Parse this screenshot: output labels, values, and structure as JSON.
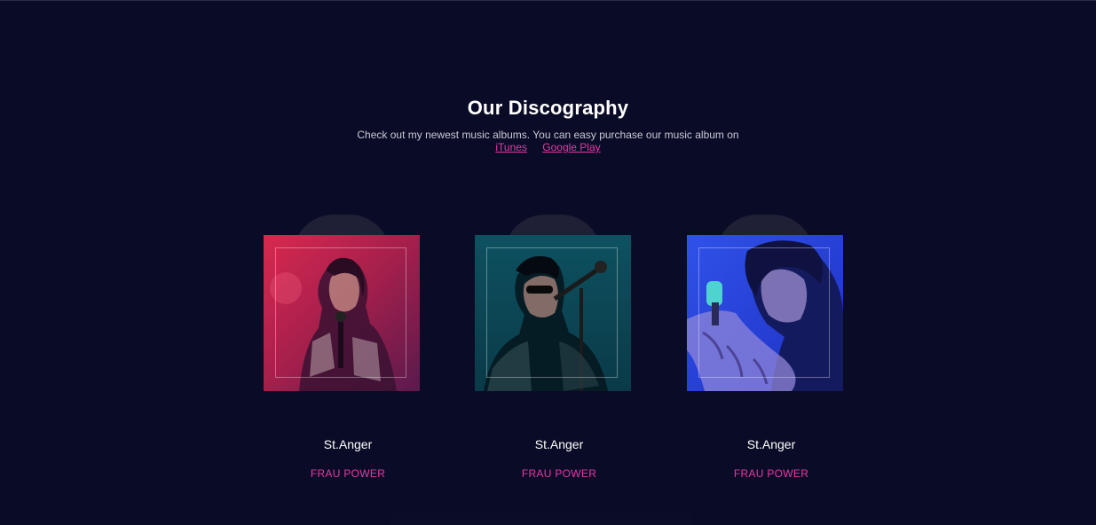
{
  "section": {
    "title": "Our Discography",
    "subtitle": "Check out my newest music albums. You can easy purchase our music album on",
    "links": [
      "iTunes",
      "Google Play"
    ]
  },
  "albums": [
    {
      "name": "St.Anger",
      "artist": "FRAU POWER",
      "tint": "#c4244d"
    },
    {
      "name": "St.Anger",
      "artist": "FRAU POWER",
      "tint": "#0c4a55"
    },
    {
      "name": "St.Anger",
      "artist": "FRAU POWER",
      "tint": "#2a3fd6"
    }
  ],
  "colors": {
    "background": "#0a0b26",
    "accent": "#e53aa7",
    "text": "#ffffff"
  }
}
